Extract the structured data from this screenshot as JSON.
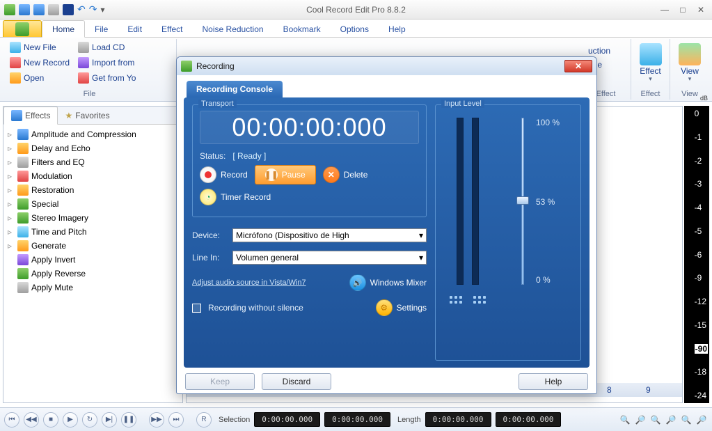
{
  "app": {
    "title": "Cool Record Edit Pro 8.8.2"
  },
  "tabs": [
    "Home",
    "File",
    "Edit",
    "Effect",
    "Noise Reduction",
    "Bookmark",
    "Options",
    "Help"
  ],
  "active_tab": "Home",
  "ribbon": {
    "file_group": "File",
    "new_file": "New File",
    "new_record": "New Record",
    "open": "Open",
    "load_cd": "Load CD",
    "import_from": "Import from",
    "get_from_yo": "Get from Yo",
    "right": {
      "uction": "uction",
      "nge": "nge",
      "effect_big": "Effect",
      "view_big": "View",
      "effect_lbl": "Effect",
      "view_lbl": "View"
    }
  },
  "sidebar": {
    "tab_effects": "Effects",
    "tab_favorites": "Favorites",
    "items": [
      "Amplitude and Compression",
      "Delay and Echo",
      "Filters and EQ",
      "Modulation",
      "Restoration",
      "Special",
      "Stereo Imagery",
      "Time and Pitch",
      "Generate",
      "Apply Invert",
      "Apply Reverse",
      "Apply Mute"
    ]
  },
  "db_labels": [
    "dB",
    "0",
    "-1",
    "-2",
    "-3",
    "-4",
    "-5",
    "-6",
    "-9",
    "-12",
    "-15",
    "-90",
    "-18",
    "-24"
  ],
  "ruler": [
    "8",
    "9"
  ],
  "status": {
    "selection": "Selection",
    "sel_from": "0:00:00.000",
    "sel_to": "0:00:00.000",
    "length": "Length",
    "len_from": "0:00:00.000",
    "len_to": "0:00:00.000"
  },
  "dialog": {
    "title": "Recording",
    "console": "Recording Console",
    "transport_legend": "Transport",
    "input_legend": "Input Level",
    "timecode": "00:00:00:000",
    "status_label": "Status:",
    "status_value": "[ Ready ]",
    "record": "Record",
    "pause": "Pause",
    "delete": "Delete",
    "timer_record": "Timer Record",
    "device_label": "Device:",
    "device_value": "Micrófono (Dispositivo de High",
    "linein_label": "Line In:",
    "linein_value": "Volumen general",
    "adjust_link": "Adjust audio source in Vista/Win7",
    "windows_mixer": "Windows Mixer",
    "rec_without_silence": "Recording without silence",
    "settings": "Settings",
    "slider_top": "100 %",
    "slider_mid": "53 %",
    "slider_bot": "0 %",
    "keep": "Keep",
    "discard": "Discard",
    "help": "Help"
  }
}
